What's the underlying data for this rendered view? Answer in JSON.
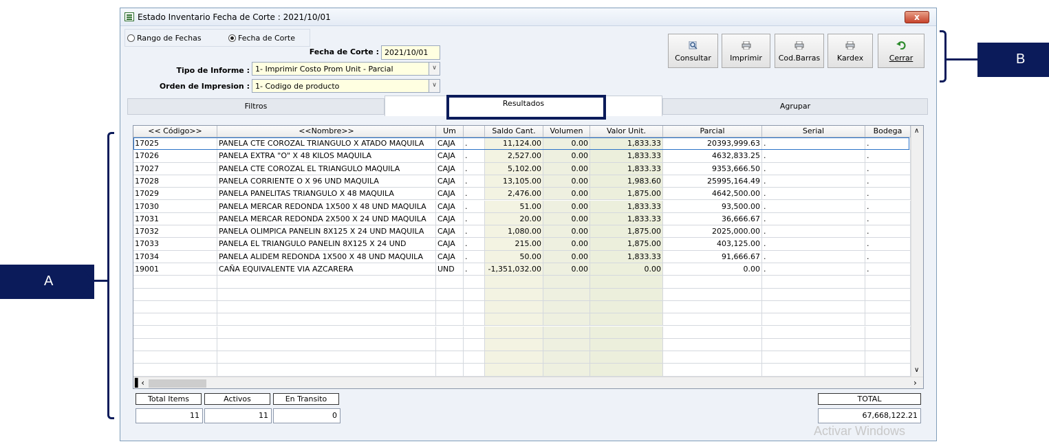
{
  "window": {
    "title": "Estado Inventario   Fecha de Corte : 2021/10/01",
    "close_glyph": "x"
  },
  "radios": {
    "range": "Rango de Fechas",
    "cutoff": "Fecha de Corte",
    "selected": "cutoff"
  },
  "form": {
    "cutoff_label": "Fecha de Corte :",
    "cutoff_value": "2021/10/01",
    "report_type_label": "Tipo de Informe :",
    "report_type_value": "1-  Imprimir Costo Prom Unit - Parcial",
    "print_order_label": "Orden de Impresion :",
    "print_order_value": "1-  Codigo de producto"
  },
  "toolbar": {
    "consultar": "Consultar",
    "imprimir": "Imprimir",
    "codbarras": "Cod.Barras",
    "kardex": "Kardex",
    "cerrar": "Cerrar"
  },
  "tabs": {
    "filtros": "Filtros",
    "resultados": "Resultados",
    "agrupar": "Agrupar",
    "active": "resultados"
  },
  "grid": {
    "columns": [
      "<< Código>>",
      "<<Nombre>>",
      "Um",
      "",
      "Saldo Cant.",
      "Volumen",
      "Valor Unit.",
      "Parcial",
      "Serial",
      "Bodega"
    ],
    "rows": [
      [
        "17025",
        "PANELA CTE COROZAL TRIANGULO X ATADO MAQUILA",
        "CAJA",
        ".",
        "11,124.00",
        "0.00",
        "1,833.33",
        "20393,999.63",
        ".",
        "."
      ],
      [
        "17026",
        "PANELA EXTRA \"O\" X 48 KILOS MAQUILA",
        "CAJA",
        ".",
        "2,527.00",
        "0.00",
        "1,833.33",
        "4632,833.25",
        ".",
        "."
      ],
      [
        "17027",
        "PANELA CTE COROZAL EL TRIANGULO MAQUILA",
        "CAJA",
        ".",
        "5,102.00",
        "0.00",
        "1,833.33",
        "9353,666.50",
        ".",
        "."
      ],
      [
        "17028",
        "PANELA CORRIENTE O X 96 UND MAQUILA",
        "CAJA",
        ".",
        "13,105.00",
        "0.00",
        "1,983.60",
        "25995,164.49",
        ".",
        "."
      ],
      [
        "17029",
        "PANELA PANELITAS TRIANGULO X 48 MAQUILA",
        "CAJA",
        ".",
        "2,476.00",
        "0.00",
        "1,875.00",
        "4642,500.00",
        ".",
        "."
      ],
      [
        "17030",
        "PANELA MERCAR REDONDA 1X500 X 48 UND MAQUILA",
        "CAJA",
        ".",
        "51.00",
        "0.00",
        "1,833.33",
        "93,500.00",
        ".",
        "."
      ],
      [
        "17031",
        "PANELA MERCAR REDONDA 2X500 X 24 UND  MAQUILA",
        "CAJA",
        ".",
        "20.00",
        "0.00",
        "1,833.33",
        "36,666.67",
        ".",
        "."
      ],
      [
        "17032",
        "PANELA OLIMPICA PANELIN 8X125  X 24 UND MAQUILA",
        "CAJA",
        ".",
        "1,080.00",
        "0.00",
        "1,875.00",
        "2025,000.00",
        ".",
        "."
      ],
      [
        "17033",
        "PANELA EL TRIANGULO PANELIN 8X125 X 24 UND",
        "CAJA",
        ".",
        "215.00",
        "0.00",
        "1,875.00",
        "403,125.00",
        ".",
        "."
      ],
      [
        "17034",
        "PANELA ALIDEM REDONDA 1X500 X 48 UND MAQUILA",
        "CAJA",
        ".",
        "50.00",
        "0.00",
        "1,833.33",
        "91,666.67",
        ".",
        "."
      ],
      [
        "19001",
        "CAÑA EQUIVALENTE VIA AZCARERA",
        "UND",
        ".",
        "-1,351,032.00",
        "0.00",
        "0.00",
        "0.00",
        ".",
        "."
      ]
    ],
    "empty_rows": 8
  },
  "summary": {
    "total_items_label": "Total  Items",
    "total_items_value": "11",
    "activos_label": "Activos",
    "activos_value": "11",
    "en_transito_label": "En Transito",
    "en_transito_value": "0",
    "total_label": "TOTAL",
    "total_value": "67,668,122.21"
  },
  "callouts": {
    "a": "A",
    "b": "B"
  },
  "watermark": "Activar Windows"
}
